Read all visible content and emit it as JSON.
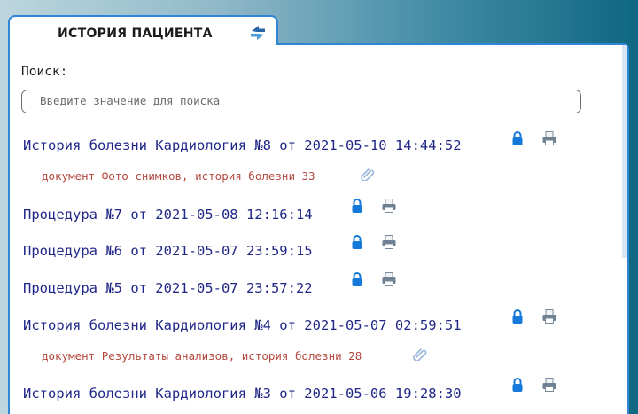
{
  "header": {
    "title": "ИСТОРИЯ ПАЦИЕНТА",
    "refresh_icon": "refresh-icon"
  },
  "search": {
    "label": "Поиск:",
    "placeholder": "Введите значение для поиска",
    "value": ""
  },
  "records": [
    {
      "title": "История болезни Кардиология №8 от 2021-05-10 14:44:52",
      "icons": [
        "lock-icon",
        "print-icon"
      ],
      "documents": [
        {
          "text": "документ Фото снимков, история болезни 33",
          "icon": "paperclip-icon"
        }
      ]
    },
    {
      "title": "Процедура №7 от 2021-05-08 12:16:14",
      "icons": [
        "lock-icon",
        "print-icon"
      ],
      "documents": []
    },
    {
      "title": "Процедура №6 от 2021-05-07 23:59:15",
      "icons": [
        "lock-icon",
        "print-icon"
      ],
      "documents": []
    },
    {
      "title": "Процедура №5 от 2021-05-07 23:57:22",
      "icons": [
        "lock-icon",
        "print-icon"
      ],
      "documents": []
    },
    {
      "title": "История болезни Кардиология №4 от 2021-05-07 02:59:51",
      "icons": [
        "lock-icon",
        "print-icon"
      ],
      "documents": [
        {
          "text": "документ Результаты анализов, история болезни 28",
          "icon": "paperclip-icon"
        }
      ]
    },
    {
      "title": "История болезни Кардиология №3 от 2021-05-06 19:28:30",
      "icons": [
        "lock-icon",
        "print-icon"
      ],
      "documents": []
    }
  ],
  "colors": {
    "accent_border": "#2f86d7",
    "record_text": "#202787",
    "document_text": "#b4493f",
    "lock_icon": "#1479d8"
  }
}
